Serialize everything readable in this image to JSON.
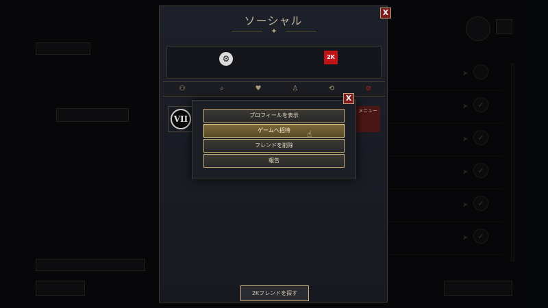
{
  "social": {
    "title": "ソーシャル",
    "close_label": "X",
    "platforms": {
      "steam_icon": "steam-icon",
      "twok_label": "2K"
    },
    "tabs": [
      {
        "name": "tab-friends",
        "glyph": "⚇"
      },
      {
        "name": "tab-search",
        "glyph": "🔍"
      },
      {
        "name": "tab-favorites",
        "glyph": "♥"
      },
      {
        "name": "tab-notifications",
        "glyph": "🔔"
      },
      {
        "name": "tab-recent",
        "glyph": "⟲"
      },
      {
        "name": "tab-blocked",
        "glyph": "⊘"
      }
    ],
    "friend": {
      "avatar_label": "VII"
    },
    "menu_label": "メニュー",
    "add_2k_friend": "2Kフレンドを探す"
  },
  "context_menu": {
    "close_label": "X",
    "items": [
      "プロフィールを表示",
      "ゲームへ招待",
      "フレンドを削除",
      "報告"
    ],
    "hovered_index": 1
  },
  "colors": {
    "accent_gold": "#c9ad74",
    "close_red": "#7d1c1c",
    "blocked_red": "#c02020"
  }
}
